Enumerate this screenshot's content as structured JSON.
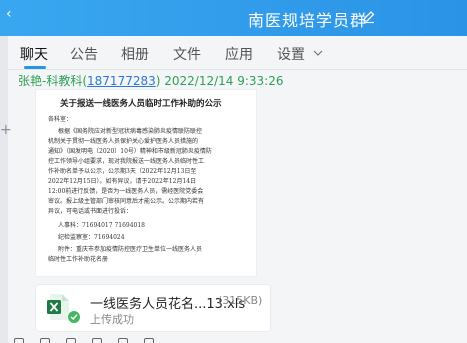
{
  "window": {
    "title": "南医规培学员群"
  },
  "tabs": [
    {
      "label": "聊天",
      "active": true
    },
    {
      "label": "公告"
    },
    {
      "label": "相册"
    },
    {
      "label": "文件"
    },
    {
      "label": "应用"
    },
    {
      "label": "设置"
    }
  ],
  "message": {
    "sender_name": "张艳-科教科",
    "sender_id": "187177283",
    "timestamp": "2022/12/14 9:33:26",
    "document": {
      "title": "关于报送一线医务人员临时工作补助的公示",
      "lines": [
        "各科室：",
        "根据《国务院应对新型冠状病毒感染肺炎疫情联防联控",
        "机制关于贯彻一线医务人员保护关心爱护医务人员措施的",
        "通知》（国发明电〔2020〕10号）精神和市级新冠肺炎疫情防",
        "控工作领导小组要求，现对我院报送一线医务人员临时性工",
        "作补助名单予以公示，公示期3天（2022年12月13日至",
        "2022年12月15日）。如有异议，请于2022年12月14日",
        "12:00前进行反馈，是否为一线医务人员，需经医院党委会",
        "审议。报上级主管部门审核同意后才能公示。公示期内若有",
        "异议，可电话或书面进行投诉：",
        "人事科：71694017 71694018",
        "纪检监察室：71694024",
        "附件：重庆市参加疫情防控医疗卫生单位一线医务人员",
        "临时性工作补助花名册"
      ]
    },
    "file": {
      "name": "一线医务人员花名...13.xls",
      "size": "(315KB)",
      "status": "上传成功"
    }
  },
  "colors": {
    "titlebar": "#2b93e6",
    "sender": "#2e9f55",
    "link": "#2b78d8",
    "success": "#43b860",
    "excel": "#1f7a45"
  }
}
